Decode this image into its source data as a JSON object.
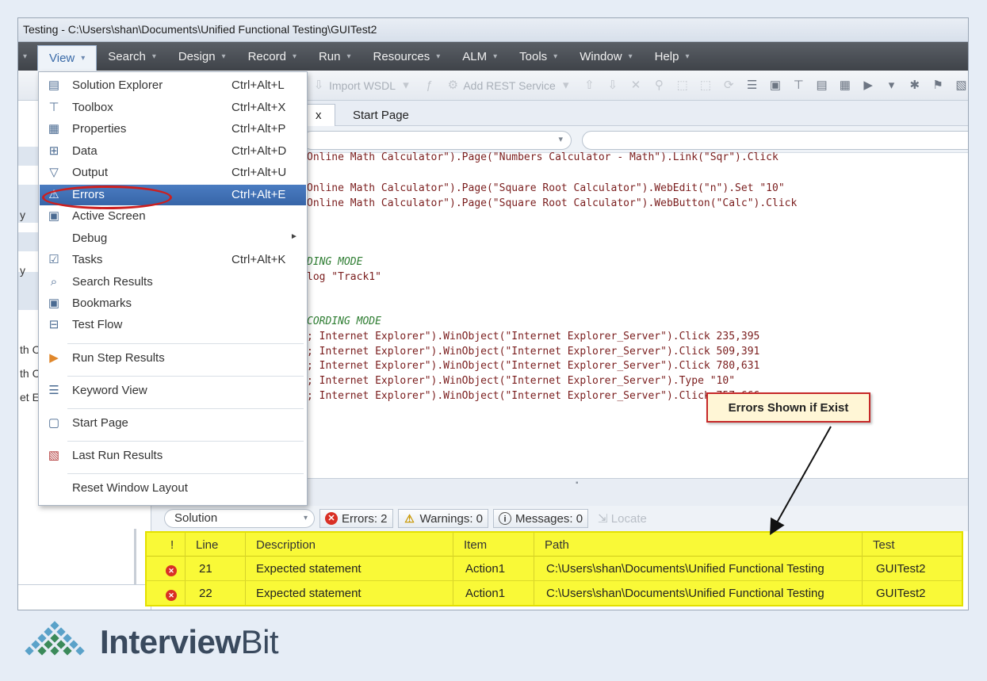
{
  "window": {
    "title": "Testing - C:\\Users\\shan\\Documents\\Unified Functional Testing\\GUITest2"
  },
  "menubar": [
    {
      "label": "View",
      "active": true
    },
    {
      "label": "Search"
    },
    {
      "label": "Design"
    },
    {
      "label": "Record"
    },
    {
      "label": "Run"
    },
    {
      "label": "Resources"
    },
    {
      "label": "ALM"
    },
    {
      "label": "Tools"
    },
    {
      "label": "Window"
    },
    {
      "label": "Help"
    }
  ],
  "toolbar": {
    "import_wsdl": "Import WSDL",
    "add_rest": "Add REST Service"
  },
  "doctabs": {
    "start_page": "Start Page",
    "active_tab_fragment": "x"
  },
  "left_fragments": [
    "y",
    "y",
    "th C",
    "th C",
    "et E"
  ],
  "view_menu": [
    {
      "label": "Solution Explorer",
      "shortcut": "Ctrl+Alt+L",
      "icon": "solution-explorer-icon"
    },
    {
      "label": "Toolbox",
      "shortcut": "Ctrl+Alt+X",
      "icon": "toolbox-icon"
    },
    {
      "label": "Properties",
      "shortcut": "Ctrl+Alt+P",
      "icon": "properties-icon"
    },
    {
      "label": "Data",
      "shortcut": "Ctrl+Alt+D",
      "icon": "data-icon"
    },
    {
      "label": "Output",
      "shortcut": "Ctrl+Alt+U",
      "icon": "output-icon"
    },
    {
      "label": "Errors",
      "shortcut": "Ctrl+Alt+E",
      "icon": "errors-icon",
      "highlighted": true
    },
    {
      "label": "Active Screen",
      "shortcut": "",
      "icon": "active-screen-icon"
    },
    {
      "label": "Debug",
      "shortcut": "",
      "icon": "",
      "submenu": true
    },
    {
      "label": "Tasks",
      "shortcut": "Ctrl+Alt+K",
      "icon": "tasks-icon"
    },
    {
      "label": "Search Results",
      "shortcut": "",
      "icon": "search-results-icon"
    },
    {
      "label": "Bookmarks",
      "shortcut": "",
      "icon": "bookmarks-icon"
    },
    {
      "label": "Test Flow",
      "shortcut": "",
      "icon": "test-flow-icon"
    },
    {
      "label": "Run Step Results",
      "shortcut": "",
      "icon": "run-step-results-icon"
    },
    {
      "label": "Keyword View",
      "shortcut": "",
      "icon": "keyword-view-icon"
    },
    {
      "label": "Start Page",
      "shortcut": "",
      "icon": "start-page-icon"
    },
    {
      "label": "Last Run Results",
      "shortcut": "",
      "icon": "last-run-results-icon"
    },
    {
      "label": "Reset Window Layout",
      "shortcut": "",
      "icon": ""
    }
  ],
  "code_lines": [
    {
      "text": "Online Math Calculator\").Page(\"Numbers Calculator - Math\").Link(\"Sqr\").Click",
      "comment": false
    },
    {
      "text": "Online Math Calculator\").Page(\"Square Root Calculator\").WebEdit(\"n\").Set \"10\"",
      "comment": false
    },
    {
      "text": "Online Math Calculator\").Page(\"Square Root Calculator\").WebButton(\"Calc\").Click",
      "comment": false
    },
    {
      "text": "DING MODE",
      "comment": true
    },
    {
      "text": "log \"Track1\"",
      "comment": false
    },
    {
      "text": "CORDING MODE",
      "comment": true
    },
    {
      "text": "; Internet Explorer\").WinObject(\"Internet Explorer_Server\").Click 235,395",
      "comment": false
    },
    {
      "text": "; Internet Explorer\").WinObject(\"Internet Explorer_Server\").Click 509,391",
      "comment": false
    },
    {
      "text": "; Internet Explorer\").WinObject(\"Internet Explorer_Server\").Click 780,631",
      "comment": false
    },
    {
      "text": "; Internet Explorer\").WinObject(\"Internet Explorer_Server\").Type \"10\"",
      "comment": false
    },
    {
      "text": "; Internet Explorer\").WinObject(\"Internet Explorer_Server\").Click 757,666",
      "comment": false
    }
  ],
  "errors_panel": {
    "scope": "Solution",
    "errors_btn": "Errors: 2",
    "warnings_btn": "Warnings: 0",
    "messages_btn": "Messages: 0",
    "locate_btn": "Locate",
    "columns": {
      "bang": "!",
      "line": "Line",
      "description": "Description",
      "item": "Item",
      "path": "Path",
      "test": "Test"
    },
    "rows": [
      {
        "line": "21",
        "description": "Expected statement",
        "item": "Action1",
        "path": "C:\\Users\\shan\\Documents\\Unified Functional Testing",
        "test": "GUITest2"
      },
      {
        "line": "22",
        "description": "Expected statement",
        "item": "Action1",
        "path": "C:\\Users\\shan\\Documents\\Unified Functional Testing",
        "test": "GUITest2"
      }
    ]
  },
  "callout": {
    "text": "Errors Shown if Exist"
  },
  "brand": {
    "name_part1": "Interview",
    "name_part2": "Bit"
  },
  "colors": {
    "menubar": "#4a4e55",
    "highlight": "#3a6aaf",
    "error_table": "#f9f937",
    "callout_border": "#c62828"
  }
}
